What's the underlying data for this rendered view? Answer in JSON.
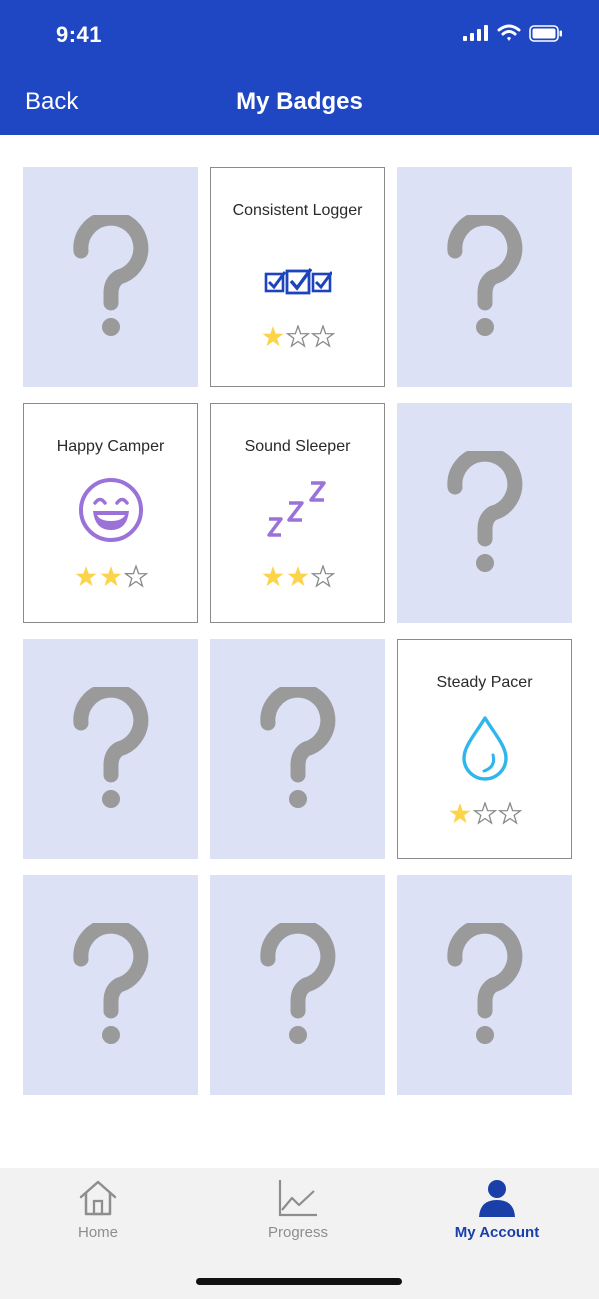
{
  "status_bar": {
    "time": "9:41"
  },
  "header": {
    "back_label": "Back",
    "title": "My Badges"
  },
  "colors": {
    "header_bg": "#2047c3",
    "locked_tile_bg": "#dde1f6",
    "question_mark": "#9a9a9a",
    "star_filled": "#fbd44a",
    "tab_active": "#1a3fa8",
    "tab_inactive": "#8e8e8e"
  },
  "badges": [
    {
      "locked": true
    },
    {
      "locked": false,
      "name": "Consistent Logger",
      "icon": "checkboxes-icon",
      "stars_earned": 1,
      "stars_total": 3
    },
    {
      "locked": true
    },
    {
      "locked": false,
      "name": "Happy Camper",
      "icon": "laughing-face-icon",
      "stars_earned": 2,
      "stars_total": 3
    },
    {
      "locked": false,
      "name": "Sound Sleeper",
      "icon": "sleep-zzz-icon",
      "stars_earned": 2,
      "stars_total": 3
    },
    {
      "locked": true
    },
    {
      "locked": true
    },
    {
      "locked": true
    },
    {
      "locked": false,
      "name": "Steady Pacer",
      "icon": "water-drop-icon",
      "stars_earned": 1,
      "stars_total": 3
    },
    {
      "locked": true
    },
    {
      "locked": true
    },
    {
      "locked": true
    }
  ],
  "tabs": [
    {
      "label": "Home",
      "icon": "home-icon",
      "active": false
    },
    {
      "label": "Progress",
      "icon": "chart-icon",
      "active": false
    },
    {
      "label": "My Account",
      "icon": "person-icon",
      "active": true
    }
  ]
}
